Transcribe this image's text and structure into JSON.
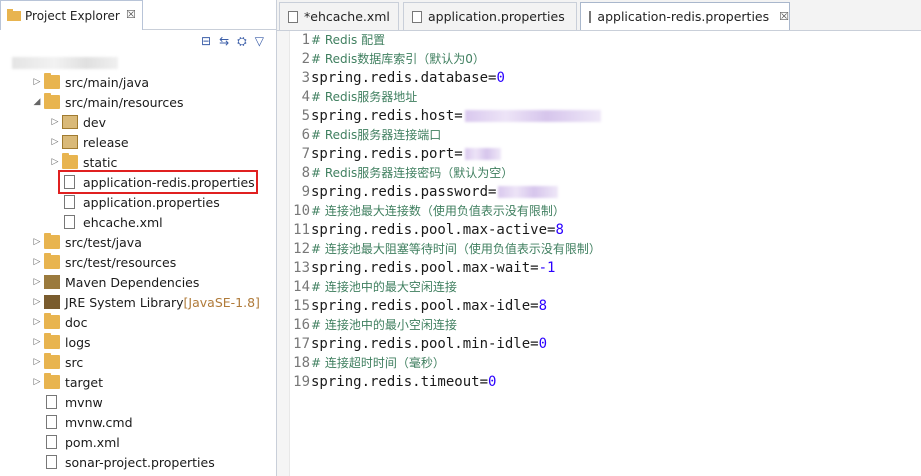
{
  "explorer": {
    "tab_label": "Project Explorer",
    "tab_close": "☒",
    "toolbar": [
      "⊟",
      "⇆",
      "⛭",
      "▽"
    ],
    "items": [
      {
        "label": "src/main/java",
        "dim": ""
      },
      {
        "label": "src/main/resources",
        "dim": ""
      },
      {
        "label": "dev",
        "dim": ""
      },
      {
        "label": "release",
        "dim": ""
      },
      {
        "label": "static",
        "dim": ""
      },
      {
        "label": "application-redis.properties",
        "dim": ""
      },
      {
        "label": "application.properties",
        "dim": ""
      },
      {
        "label": "ehcache.xml",
        "dim": ""
      },
      {
        "label": "src/test/java",
        "dim": ""
      },
      {
        "label": "src/test/resources",
        "dim": ""
      },
      {
        "label": "Maven Dependencies",
        "dim": ""
      },
      {
        "label": "JRE System Library ",
        "dim": "[JavaSE-1.8]"
      },
      {
        "label": "doc",
        "dim": ""
      },
      {
        "label": "logs",
        "dim": ""
      },
      {
        "label": "src",
        "dim": ""
      },
      {
        "label": "target",
        "dim": ""
      },
      {
        "label": "mvnw",
        "dim": ""
      },
      {
        "label": "mvnw.cmd",
        "dim": ""
      },
      {
        "label": "pom.xml",
        "dim": ""
      },
      {
        "label": "sonar-project.properties",
        "dim": ""
      }
    ]
  },
  "editor": {
    "tabs": [
      {
        "label": "*ehcache.xml"
      },
      {
        "label": "application.properties"
      },
      {
        "label": "application-redis.properties",
        "close": "☒"
      }
    ],
    "line_numbers": [
      "1",
      "2",
      "3",
      "4",
      "5",
      "6",
      "7",
      "8",
      "9",
      "10",
      "11",
      "12",
      "13",
      "14",
      "15",
      "16",
      "17",
      "18",
      "19"
    ],
    "lines": [
      {
        "c": "# Redis 配置"
      },
      {
        "c": "# Redis数据库索引（默认为0）"
      },
      {
        "k": "spring.redis.database=",
        "v": "0"
      },
      {
        "c": "# Redis服务器地址"
      },
      {
        "k": "spring.redis.host=",
        "v": ""
      },
      {
        "c": "# Redis服务器连接端口"
      },
      {
        "k": "spring.redis.port=",
        "v": ""
      },
      {
        "c": "# Redis服务器连接密码（默认为空）"
      },
      {
        "k": "spring.redis.password=",
        "v": ""
      },
      {
        "c": "# 连接池最大连接数（使用负值表示没有限制）"
      },
      {
        "k": "spring.redis.pool.max-active=",
        "v": "8"
      },
      {
        "c": "# 连接池最大阻塞等待时间（使用负值表示没有限制）"
      },
      {
        "k": "spring.redis.pool.max-wait=",
        "v": "-1"
      },
      {
        "c": "# 连接池中的最大空闲连接"
      },
      {
        "k": "spring.redis.pool.max-idle=",
        "v": "8"
      },
      {
        "c": "# 连接池中的最小空闲连接"
      },
      {
        "k": "spring.redis.pool.min-idle=",
        "v": "0"
      },
      {
        "c": "# 连接超时时间（毫秒）"
      },
      {
        "k": "spring.redis.timeout=",
        "v": "0"
      }
    ]
  }
}
